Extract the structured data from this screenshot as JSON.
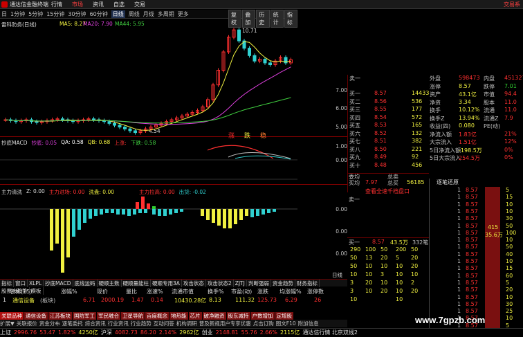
{
  "titlebar": {
    "app_title": "通达信金融终端",
    "menus": [
      "行情",
      "市场",
      "资讯",
      "自选",
      "交易"
    ],
    "active_menu": "市场",
    "right_text": "交易系"
  },
  "toolbar": {
    "periods": [
      "日",
      "1分钟",
      "5分钟",
      "15分钟",
      "30分钟",
      "60分钟",
      "日线",
      "周线",
      "月线",
      "多周期",
      "更多"
    ],
    "selected_period": "日线",
    "tools": [
      "复权",
      "叠加",
      "历史",
      "统计",
      "指标"
    ]
  },
  "main_chart": {
    "stock_label": "雷科防务(日线)",
    "ma5": "MA5: 8.27",
    "ma20": "MA20: 7.90",
    "ma44": "MA44: 5.95",
    "high_marker": "10.71",
    "low_marker": "4.54",
    "signals": [
      "涨",
      "跌",
      "稳"
    ],
    "yticks": [
      "7.00",
      "6.00",
      "5.00"
    ]
  },
  "macd_panel": {
    "label": "抄底MACD",
    "v1": "抄底: 0.05",
    "v2": "QA: 0.58",
    "v3": "QB: 0.68",
    "v4": "上涨: ",
    "v5": "下跌: 0.58",
    "yticks": [
      "1.00",
      "0.00"
    ]
  },
  "flow_panel": {
    "label": "主力清洗",
    "v1": "Z: 0.00",
    "v2": "主力进场: 0.00",
    "v3": "洗盘: 0.00",
    "v4": "主力拉高: 0.00",
    "v5": "出货: -0.02",
    "yticks": [
      "0.00",
      "0.00",
      "0.00"
    ]
  },
  "quote": {
    "sell": [
      {
        "label": "卖一",
        "price": "",
        "vol": ""
      },
      {
        "label": "卖二",
        "price": "",
        "vol": ""
      }
    ],
    "buy": [
      {
        "label": "买一",
        "price": "8.57",
        "vol": "14433"
      },
      {
        "label": "买二",
        "price": "8.56",
        "vol": "536"
      },
      {
        "label": "买三",
        "price": "8.55",
        "vol": "177"
      },
      {
        "label": "买四",
        "price": "8.54",
        "vol": "572"
      },
      {
        "label": "买五",
        "price": "8.53",
        "vol": "165"
      },
      {
        "label": "买六",
        "price": "8.52",
        "vol": "132"
      },
      {
        "label": "买七",
        "price": "8.51",
        "vol": "382"
      },
      {
        "label": "买八",
        "price": "8.50",
        "vol": "221"
      },
      {
        "label": "买九",
        "price": "8.49",
        "vol": "92"
      },
      {
        "label": "买十",
        "price": "8.48",
        "vol": "456"
      }
    ],
    "stats": [
      {
        "k": "外盘",
        "v": "598473",
        "k2": "内盘",
        "v2": "451327"
      },
      {
        "k": "涨停",
        "v": "8.57",
        "k2": "跌停",
        "v2": "7.01"
      },
      {
        "k": "资产",
        "v": "43.1亿",
        "k2": "市值",
        "v2": "94.4"
      },
      {
        "k": "净资",
        "v": "3.34",
        "k2": "股本",
        "v2": "11.0"
      },
      {
        "k": "换手",
        "v": "10.12%",
        "k2": "流通",
        "v2": "11.0"
      },
      {
        "k": "换手Z",
        "v": "13.94%",
        "k2": "流通Z",
        "v2": "7.9"
      },
      {
        "k": "收益(四)",
        "v": "0.080",
        "k2": "PE(动)",
        "v2": ""
      },
      {
        "k": "净流入额",
        "v": "1.83亿",
        "k2": "",
        "v2": "21%"
      },
      {
        "k": "大宗流入",
        "v": "1.51亿",
        "k2": "",
        "v2": "12%"
      },
      {
        "k": "5日净流入额",
        "v": "-198.5万",
        "k2": "",
        "v2": "0%"
      },
      {
        "k": "5日大宗流入",
        "v": "254.5万",
        "k2": "",
        "v2": "0%"
      }
    ],
    "weibi_label": "委均",
    "weibi_val": "",
    "waip_label": "买均",
    "waip_val": "7.97",
    "zongmai_label": "总卖",
    "zongmai_val": "",
    "zongmai2_label": "总买",
    "zongmai2_val": "56185",
    "link": "查看全速千档盘口",
    "sell1_label": "卖一",
    "buy1_label": "买一",
    "buy1_price": "8.57",
    "buy1_qty": "43.5万",
    "buy1_orders": "332笔"
  },
  "ticks": {
    "title": "逐笔还原",
    "rows": [
      {
        "t": "1",
        "p": "8.57",
        "v": "5"
      },
      {
        "t": "1",
        "p": "8.57",
        "v": "15"
      },
      {
        "t": "1",
        "p": "8.57",
        "v": "10"
      },
      {
        "t": "1",
        "p": "8.57",
        "v": "10"
      },
      {
        "t": "1",
        "p": "8.57",
        "v": "30"
      },
      {
        "t": "1",
        "p": "8.57",
        "v": "50"
      },
      {
        "t": "1",
        "p": "8.57",
        "v": "100"
      },
      {
        "t": "1",
        "p": "8.57",
        "v": "10"
      },
      {
        "t": "1",
        "p": "8.57",
        "v": "50"
      },
      {
        "t": "1",
        "p": "8.57",
        "v": "40"
      },
      {
        "t": "1",
        "p": "8.57",
        "v": "10"
      },
      {
        "t": "1",
        "p": "8.57",
        "v": "15"
      },
      {
        "t": "1",
        "p": "8.57",
        "v": "60"
      },
      {
        "t": "1",
        "p": "8.57",
        "v": "5"
      },
      {
        "t": "1",
        "p": "8.57",
        "v": "20"
      },
      {
        "t": "1",
        "p": "8.57",
        "v": "10"
      },
      {
        "t": "1",
        "p": "8.57",
        "v": "30"
      },
      {
        "t": "1",
        "p": "8.57",
        "v": "25"
      },
      {
        "t": "1",
        "p": "8.57",
        "v": "10"
      },
      {
        "t": "1",
        "p": "8.57",
        "v": "5"
      }
    ],
    "big_vol": "415",
    "big_pct": "35.6万"
  },
  "book_grid": [
    [
      "290",
      "100",
      "50",
      "200",
      "50"
    ],
    [
      "50",
      "13",
      "20",
      "5",
      "20"
    ],
    [
      "50",
      "10",
      "10",
      "10",
      "20"
    ],
    [
      "10",
      "10",
      "3",
      "10",
      "10"
    ],
    [
      "3",
      "20",
      "10",
      "10",
      "2"
    ],
    [
      "3",
      "10",
      "20",
      "10",
      "20"
    ],
    [
      "10",
      "",
      "",
      "10",
      ""
    ]
  ],
  "bottom_tabs": [
    "指标",
    "窗口",
    "XLPL",
    "抄底MACD",
    "底线运码",
    "硬顺主数",
    "硬顺量能柱",
    "硬顺专用3A",
    "攻击状态",
    "攻击状态2",
    "ZJTJ",
    "判断强弱",
    "资金趋势",
    "财务指标",
    "股票大趋势",
    "模板"
  ],
  "bottom_right_label": "日线",
  "list": {
    "headers": [
      "名称(15)",
      "涨幅%",
      "现价",
      "量比",
      "涨速%",
      "流通市值",
      "换手%",
      "市盈(动)",
      "涨跌",
      "均涨幅%",
      "涨停数"
    ],
    "row": {
      "idx": "1",
      "name": "通信设备",
      "tag": "(板块)",
      "chg": "6.71",
      "price": "2000.19",
      "lb": "1.47",
      "speed": "0.14",
      "mv": "10430.28亿",
      "hs": "8.13",
      "pe": "111.32",
      "zd": "125.73",
      "avg": "6.29",
      "zt": "26"
    }
  },
  "sectors": [
    "关联品种",
    "通信设备",
    "江苏板块",
    "国防军工",
    "军民融合",
    "卫星导航",
    "百度概念",
    "地热能",
    "芯片",
    "破净融资",
    "股东减持",
    "户数增加",
    "定增股"
  ],
  "news": [
    "扩展▼",
    "关联报价",
    "资金分布",
    "逐笔委托",
    "综合资讯",
    "行业资讯",
    "行业趋势",
    "互动问答",
    "机构调研",
    "普及新规用户专享优惠",
    "点击订购",
    "图文F10",
    "附加信息"
  ],
  "status": {
    "items": [
      {
        "name": "上证",
        "val": "2996.76",
        "chg": "53.47",
        "pct": "1.82%",
        "amt": "4250亿"
      },
      {
        "name": "沪深",
        "val": "4082.73",
        "chg": "86.20",
        "pct": "2.14%",
        "amt": "2962亿"
      },
      {
        "name": "创业",
        "val": "2148.81",
        "chg": "55.76",
        "pct": "2.66%",
        "amt": "2115亿"
      }
    ],
    "right": "通达信行情 北京双线2"
  },
  "watermark": "www.7gpzb.com",
  "colors": {
    "up": "#ff3030",
    "down": "#30d0d0",
    "ma5": "#f0f040",
    "ma20": "#e040e0",
    "ma44": "#40d040"
  }
}
